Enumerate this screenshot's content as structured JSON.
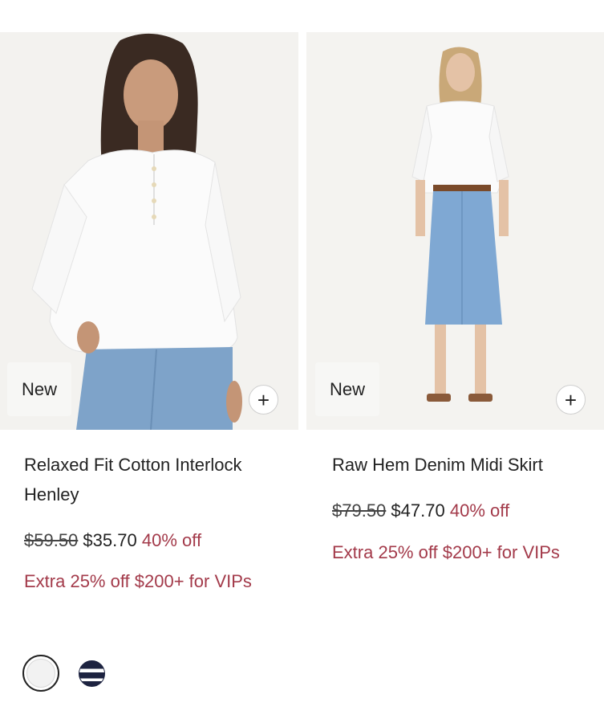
{
  "products": [
    {
      "badge": "New",
      "title": "Relaxed Fit Cotton Interlock Henley",
      "price_original": "$59.50",
      "price_sale": "$35.70",
      "discount": "40% off",
      "promo": "Extra 25% off $200+ for VIPs",
      "add_label": "+",
      "image": "woman-white-henley-blue-jeans",
      "swatches": [
        "white",
        "navy-stripe"
      ]
    },
    {
      "badge": "New",
      "title": "Raw Hem Denim Midi Skirt",
      "price_original": "$79.50",
      "price_sale": "$47.70",
      "discount": "40% off",
      "promo": "Extra 25% off $200+ for VIPs",
      "add_label": "+",
      "image": "woman-white-shirt-denim-midi-skirt"
    }
  ],
  "colors": {
    "sale_red": "#a33a4a",
    "text": "#222222",
    "badge_bg": "#f7f7f5"
  }
}
